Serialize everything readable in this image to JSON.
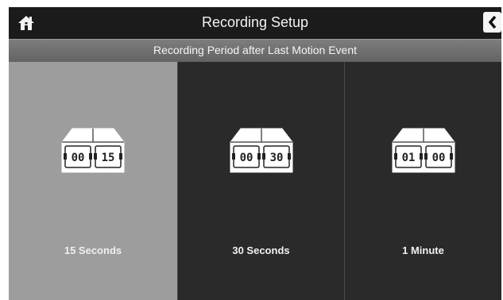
{
  "header": {
    "title": "Recording Setup",
    "home_icon": "home-icon",
    "back_icon": "back-arrow-icon"
  },
  "subheader": {
    "text": "Recording Period after Last Motion Event"
  },
  "options": [
    {
      "label": "15 Seconds",
      "digits": [
        "00",
        "15"
      ],
      "selected": true
    },
    {
      "label": "30 Seconds",
      "digits": [
        "00",
        "30"
      ],
      "selected": false
    },
    {
      "label": "1 Minute",
      "digits": [
        "01",
        "00"
      ],
      "selected": false
    }
  ],
  "colors": {
    "selected_bg": "#9d9d9d",
    "option_bg": "#2a2a2a",
    "topbar_bg": "#1b1b1b"
  }
}
